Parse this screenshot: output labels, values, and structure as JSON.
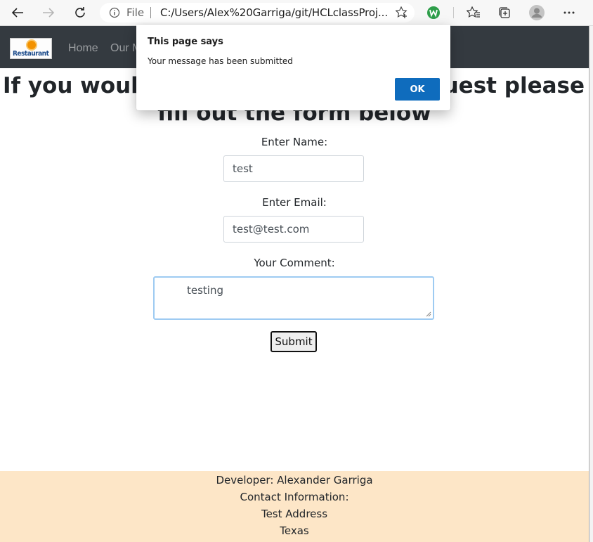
{
  "browser": {
    "address_info_icon": "info-icon",
    "address_file_label": "File",
    "address_url": "C:/Users/Alex%20Garriga/git/HCLclassProj..."
  },
  "navbar": {
    "logo_text": "Restaurant",
    "links": [
      "Home",
      "Our M"
    ]
  },
  "page": {
    "heading_line1_left": "If you would",
    "heading_line1_right": "equest please",
    "heading_line2": "fill out the form below"
  },
  "form": {
    "name_label": "Enter Name:",
    "name_value": "test",
    "email_label": "Enter Email:",
    "email_value": "test@test.com",
    "comment_label": "Your Comment:",
    "comment_value": "testing",
    "submit_label": "Submit"
  },
  "footer": {
    "lines": [
      "Developer: Alexander Garriga",
      "Contact Information:",
      "Test Address",
      "Texas"
    ]
  },
  "dialog": {
    "title": "This page says",
    "message": "Your message has been submitted",
    "ok_label": "OK"
  },
  "colors": {
    "navbar_bg": "#343a40",
    "footer_bg": "#fde6c7",
    "ok_button": "#0f6cbd"
  }
}
